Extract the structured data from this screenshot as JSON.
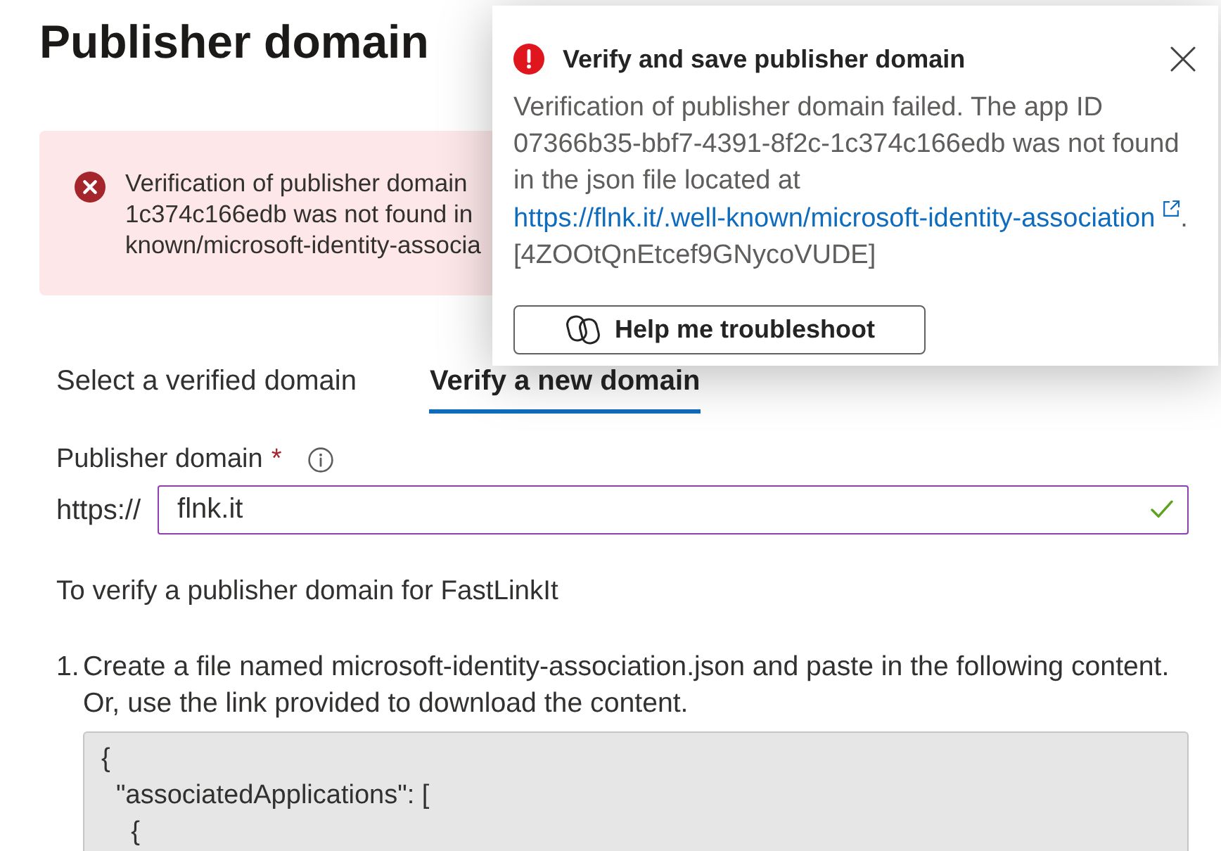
{
  "page": {
    "title": "Publisher domain"
  },
  "error_banner": {
    "message_lines": [
      "Verification of publisher domain",
      "1c374c166edb was not found in",
      "known/microsoft-identity-associa"
    ]
  },
  "tabs": [
    {
      "label": "Select a verified domain",
      "selected": false
    },
    {
      "label": "Verify a new domain",
      "selected": true
    }
  ],
  "publisher_domain": {
    "label": "Publisher domain",
    "required_mark": "*",
    "prefix": "https://",
    "value": "flnk.it",
    "valid": true,
    "edited": true
  },
  "instructions": {
    "intro": "To verify a publisher domain for FastLinkIt",
    "steps": [
      {
        "number": "1.",
        "text": "Create a file named microsoft-identity-association.json and paste in the following content. Or, use the link provided to download the content.",
        "code_lines": [
          "{",
          "  \"associatedApplications\": [",
          "    {"
        ]
      }
    ]
  },
  "notification": {
    "title": "Verify and save publisher domain",
    "message": "Verification of publisher domain failed. The app ID 07366b35-bbf7-4391-8f2c-1c374c166edb was not found in the json file located at",
    "link": "https://flnk.it/.well-known/microsoft-identity-association",
    "message_end": ". [4ZOOtQnEtcef9GNycoVUDE]",
    "button": "Help me troubleshoot"
  }
}
